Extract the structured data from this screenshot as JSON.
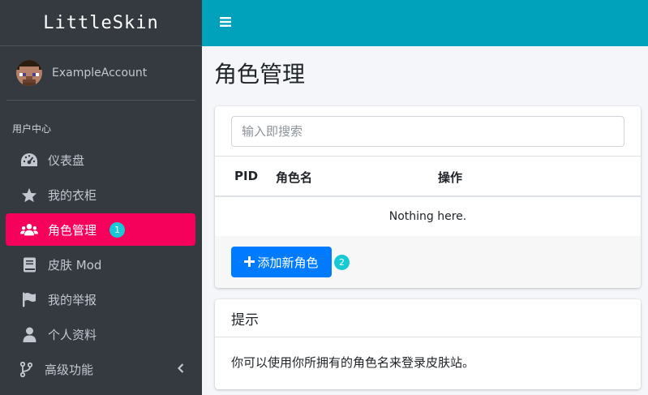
{
  "brand": "LittleSkin",
  "user": {
    "name": "ExampleAccount"
  },
  "nav": {
    "header": "用户中心",
    "items": [
      {
        "label": "仪表盘",
        "icon": "dashboard-icon"
      },
      {
        "label": "我的衣柜",
        "icon": "star-icon"
      },
      {
        "label": "角色管理",
        "icon": "users-icon",
        "active": true,
        "badge": "1"
      },
      {
        "label": "皮肤 Mod",
        "icon": "book-icon"
      },
      {
        "label": "我的举报",
        "icon": "flag-icon"
      },
      {
        "label": "个人资料",
        "icon": "user-icon"
      },
      {
        "label": "高级功能",
        "icon": "code-branch-icon",
        "chevron": "chevron-left-icon"
      }
    ]
  },
  "page": {
    "title": "角色管理"
  },
  "players_card": {
    "search_placeholder": "输入即搜索",
    "columns": [
      "PID",
      "角色名",
      "操作"
    ],
    "empty_text": "Nothing here.",
    "add_button": "添加新角色",
    "add_badge": "2"
  },
  "tip_card": {
    "title": "提示",
    "body": "你可以使用你所拥有的角色名来登录皮肤站。"
  },
  "colors": {
    "sidebar": "#343a40",
    "topbar": "#00a2bb",
    "active_nav": "#f5005b",
    "badge": "#17c8d6",
    "primary": "#007bff"
  }
}
